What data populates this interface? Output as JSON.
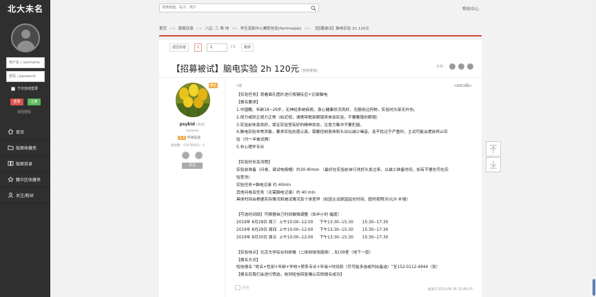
{
  "site": {
    "title": "北大未名"
  },
  "login": {
    "username_placeholder": "用户名 / username",
    "password_placeholder": "密码 / password",
    "remember_label": "下次自动登录",
    "login_label": "登录",
    "register_label": "注册",
    "forgot_label": "找回密码"
  },
  "nav": {
    "items": [
      {
        "label": "首页",
        "icon": "home-icon"
      },
      {
        "label": "版面收藏夹",
        "icon": "folder-icon"
      },
      {
        "label": "版面目录",
        "icon": "book-icon"
      },
      {
        "label": "籍中区收藏夹",
        "icon": "bookmark-icon"
      },
      {
        "label": "关注/粉丝",
        "icon": "user-icon"
      }
    ]
  },
  "topbar": {
    "search_placeholder": "搜索版面、帖子、用户",
    "help_label": "帮助中心"
  },
  "breadcrumb": {
    "items": [
      "首页",
      "版面目录",
      "八区: 三 角 地",
      "学生资助中心兼职信息(PartimeJob)",
      "【招募被试】脑电实验 2h 120元"
    ],
    "separator": ">>"
  },
  "pager": {
    "back_label": "返回本版",
    "current_page": "1",
    "page_input": "1",
    "total": "/ 1",
    "jump_label": "跳转"
  },
  "post": {
    "title": "【招募被试】脑电实验 2h 120元",
    "copy_link_label": "[复制链接]",
    "share_label": "分享：",
    "author": {
      "host_tag": "楼主",
      "username": "psykid",
      "username_suffix": "[离线]",
      "nickname": "nonono",
      "level_num": "3.3",
      "level_name": "中级站友",
      "stats": "发帖数：439   原创分：0",
      "follow_label": "关注"
    },
    "floor": "1楼",
    "ascii_label": "<ASCII码>",
    "lines": [
      "【实验任务】观看面孔图片进行按键反应+记录脑电",
      "【报名要求】",
      "1.中国籍、年龄18~26岁，无神经系统疾病、身心健康状况良好、无服用过药物，实验时头部无外伤。",
      "2.视力或矫正视力正常（如近视，请携带框架眼镜来参加实验，不要戴隐形眼镜）",
      "3.实验前休息良好，保证实验室有好的精神状态，注意力集中不要犯困。",
      "4.脑电实验非常灵敏，要求实验态度认真。需要控制身体和头动以减少噪音。连干扰过于严重时，主试可能会提前终止实",
      "验（付一半被试费）",
      "5.非心理学专业",
      "",
      "【实验时长及流程】",
      "实验前准备（问卷、调试电极帽）约30-40min （最好在实验前自行洗好头发过来，以减少准备时间，如有不便也可在实",
      "验室洗）",
      "实验任务+脑电记录 约 40min",
      "其他问卷及任务（无需脑电记录）约 40 min",
      "具体时间会根据实际情况和被试情况及个体差异（如因主试原因延长时间，超时按照30元/h 补偿）",
      "",
      "【可选时间段】可根据自己时间做微调整（如半小时 幅度）",
      "2019年 8月28日 周三  上午10:00--12:00     下午13:30--15:30       15:30--17:30",
      "2019年 8月29日 周四  上午10:00--12:00     下午13:30--15:30       15:30--17:30",
      "2019年 8月30日 周五  上午10:00--12:00     下午13:30--15:30       15:30--17:30",
      "",
      "【实验地点】北京大学综合科研楼（二体网球场南侧）, B109室（地下一层）",
      "【报名方式】",
      "短信报名 \"姓名+性别+年龄+学校+院系专业+年级+时间段（尽可能多选或列出备选）\"至152-0112-4944（张）",
      "【报名后我们会进行筛选，收到短信回复确认后即报名成功】"
    ],
    "reply_label": "回复",
    "post_time": "发表于2019-08-26 10:46:05"
  }
}
